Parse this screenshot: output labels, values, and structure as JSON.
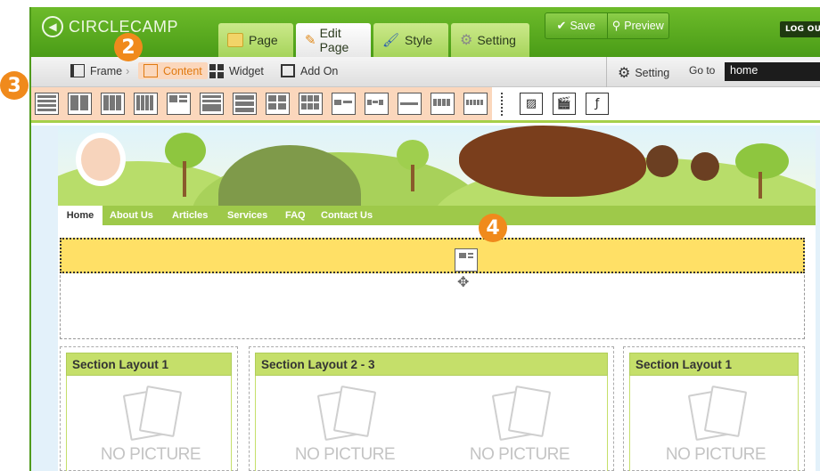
{
  "app": {
    "logo_text": "CIRCLECAMP",
    "tabs": [
      {
        "label": "Page",
        "active": false
      },
      {
        "label": "Edit Page",
        "active": true
      },
      {
        "label": "Style",
        "active": false
      },
      {
        "label": "Setting",
        "active": false
      }
    ],
    "save_label": "Save",
    "preview_label": "Preview",
    "logout_label": "LOG OU"
  },
  "toolbar": {
    "frame_label": "Frame",
    "content_label": "Content",
    "widget_label": "Widget",
    "addon_label": "Add On",
    "setting_label": "Setting",
    "goto_label": "Go to",
    "goto_value": "home"
  },
  "steps": {
    "two": "2",
    "three": "3",
    "four": "4"
  },
  "site": {
    "nav": [
      "Home",
      "About Us",
      "Articles",
      "Services",
      "FAQ",
      "Contact Us"
    ],
    "sections": [
      {
        "title": "Section Layout 1",
        "pictures": [
          "NO PICTURE"
        ]
      },
      {
        "title": "Section Layout 2 - 3",
        "pictures": [
          "NO PICTURE",
          "NO PICTURE"
        ]
      },
      {
        "title": "Section Layout 1",
        "pictures": [
          "NO PICTURE"
        ]
      }
    ]
  },
  "colors": {
    "brand_green": "#4a9c17",
    "accent_orange": "#f08a1c",
    "nav_green": "#9ec94a",
    "dropzone_yellow": "#ffe066"
  },
  "icons": [
    "circle-logo-icon",
    "page-icon",
    "pencil-icon",
    "brush-icon",
    "gear-icon",
    "check-icon",
    "magnifier-icon",
    "frame-icon",
    "content-icon",
    "widget-icon",
    "addon-icon",
    "image-icon",
    "video-icon",
    "flash-icon",
    "move-icon"
  ]
}
